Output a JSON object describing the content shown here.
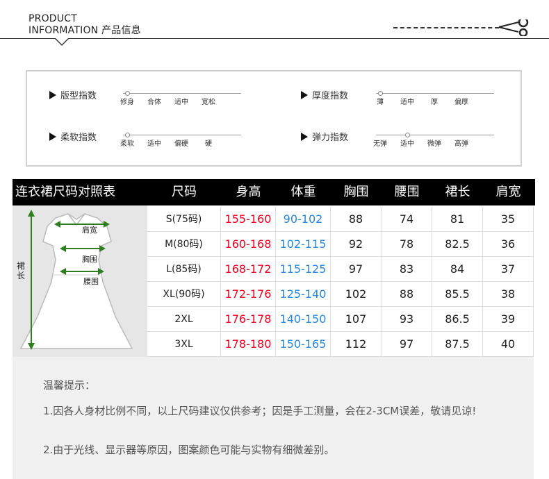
{
  "header": {
    "title_line1": "PRODUCT",
    "title_line2": "INFORMATION 产品信息"
  },
  "index_panel": {
    "rows": [
      {
        "label": "版型指数",
        "options": [
          "修身",
          "合体",
          "适中",
          "宽松"
        ],
        "selected": 0
      },
      {
        "label": "厚度指数",
        "options": [
          "薄",
          "适中",
          "厚",
          "偏厚"
        ],
        "selected": 0
      },
      {
        "label": "柔软指数",
        "options": [
          "柔软",
          "适中",
          "偏硬",
          "硬"
        ],
        "selected": 0
      },
      {
        "label": "弹力指数",
        "options": [
          "无弹",
          "适中",
          "微弹",
          "高弹"
        ],
        "selected": 1
      }
    ]
  },
  "size_table": {
    "title": "连衣裙尺码对照表",
    "columns": [
      "尺码",
      "身高",
      "体重",
      "胸围",
      "腰围",
      "裙长",
      "肩宽"
    ],
    "rows": [
      [
        "S(75码)",
        "155-160",
        "90-102",
        "88",
        "74",
        "81",
        "35"
      ],
      [
        "M(80码)",
        "160-168",
        "102-115",
        "92",
        "78",
        "82.5",
        "36"
      ],
      [
        "L(85码)",
        "168-172",
        "115-125",
        "97",
        "83",
        "84",
        "37"
      ],
      [
        "XL(90码)",
        "172-176",
        "125-140",
        "102",
        "88",
        "85.5",
        "38"
      ],
      [
        "2XL",
        "176-178",
        "140-150",
        "107",
        "93",
        "86.5",
        "39"
      ],
      [
        "3XL",
        "178-180",
        "150-165",
        "112",
        "97",
        "87.5",
        "40"
      ]
    ],
    "figure_labels": {
      "shoulder": "肩宽",
      "chest": "胸围",
      "waist": "腰围",
      "length_char1": "裙",
      "length_char2": "长"
    },
    "colors": {
      "height": "#e8001c",
      "weight": "#2a86d8",
      "arrow": "#2e7d1e"
    }
  },
  "tips": {
    "title": "温馨提示：",
    "items": [
      "1.因各人身材比例不同，以上尺码建议仅供参考；因是手工测量，会在2-3CM误差，敬请见谅!",
      "2.由于光线、显示器等原因，图案颜色可能与实物有细微差别。"
    ]
  }
}
